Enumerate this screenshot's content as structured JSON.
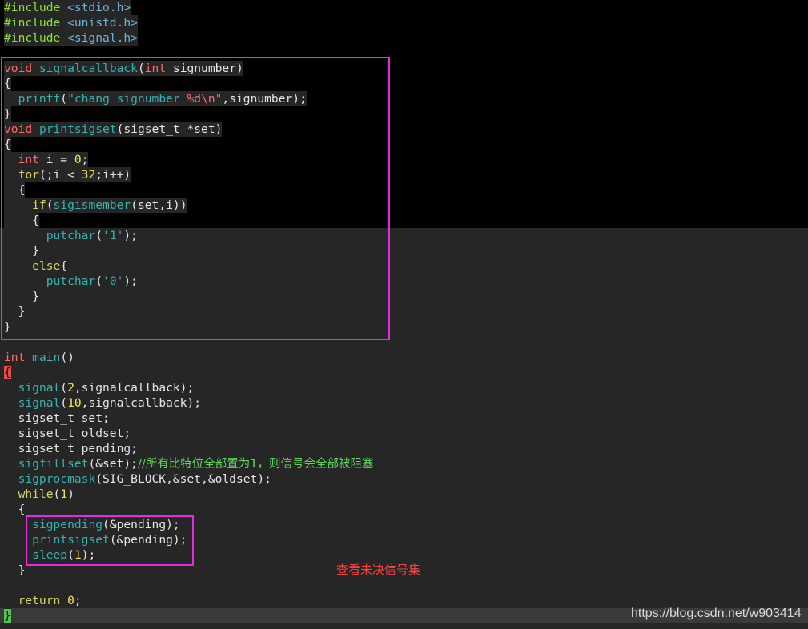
{
  "editor": {
    "lines": [
      [
        [
          "pre",
          "#include "
        ],
        [
          "header",
          "<stdio.h>"
        ]
      ],
      [
        [
          "pre",
          "#include "
        ],
        [
          "header",
          "<unistd.h>"
        ]
      ],
      [
        [
          "pre",
          "#include "
        ],
        [
          "header",
          "<signal.h>"
        ]
      ],
      [],
      [
        [
          "type",
          "void"
        ],
        [
          "plain",
          " "
        ],
        [
          "func",
          "signalcallback"
        ],
        [
          "plain",
          "("
        ],
        [
          "type",
          "int"
        ],
        [
          "plain",
          " signumber)"
        ]
      ],
      [
        [
          "plain",
          "{"
        ]
      ],
      [
        [
          "plain",
          "  "
        ],
        [
          "func",
          "printf"
        ],
        [
          "plain",
          "("
        ],
        [
          "str",
          "\"chang signumber "
        ],
        [
          "fmt",
          "%d\\n"
        ],
        [
          "str",
          "\""
        ],
        [
          "plain",
          ",signumber);"
        ]
      ],
      [
        [
          "plain",
          "}"
        ]
      ],
      [
        [
          "type",
          "void"
        ],
        [
          "plain",
          " "
        ],
        [
          "func",
          "printsigset"
        ],
        [
          "plain",
          "(sigset_t *set)"
        ]
      ],
      [
        [
          "plain",
          "{"
        ]
      ],
      [
        [
          "plain",
          "  "
        ],
        [
          "type",
          "int"
        ],
        [
          "plain",
          " i = "
        ],
        [
          "num",
          "0"
        ],
        [
          "plain",
          ";"
        ]
      ],
      [
        [
          "plain",
          "  "
        ],
        [
          "kw",
          "for"
        ],
        [
          "plain",
          "(;i < "
        ],
        [
          "num",
          "32"
        ],
        [
          "plain",
          ";i++)"
        ]
      ],
      [
        [
          "plain",
          "  {"
        ]
      ],
      [
        [
          "plain",
          "    "
        ],
        [
          "kw",
          "if"
        ],
        [
          "plain",
          "("
        ],
        [
          "func",
          "sigismember"
        ],
        [
          "plain",
          "(set,i))"
        ]
      ],
      [
        [
          "plain",
          "    {"
        ]
      ],
      [
        [
          "plain",
          "      "
        ],
        [
          "func",
          "putchar"
        ],
        [
          "plain",
          "("
        ],
        [
          "str",
          "'1'"
        ],
        [
          "plain",
          ");"
        ]
      ],
      [
        [
          "plain",
          "    }"
        ]
      ],
      [
        [
          "plain",
          "    "
        ],
        [
          "kw",
          "else"
        ],
        [
          "plain",
          "{"
        ]
      ],
      [
        [
          "plain",
          "      "
        ],
        [
          "func",
          "putchar"
        ],
        [
          "plain",
          "("
        ],
        [
          "str",
          "'0'"
        ],
        [
          "plain",
          ");"
        ]
      ],
      [
        [
          "plain",
          "    }"
        ]
      ],
      [
        [
          "plain",
          "  }"
        ]
      ],
      [
        [
          "plain",
          "}"
        ]
      ],
      [],
      [
        [
          "type",
          "int"
        ],
        [
          "plain",
          " "
        ],
        [
          "func",
          "main"
        ],
        [
          "plain",
          "()"
        ]
      ],
      [
        [
          "brace-red",
          "{"
        ]
      ],
      [
        [
          "plain",
          "  "
        ],
        [
          "func",
          "signal"
        ],
        [
          "plain",
          "("
        ],
        [
          "num",
          "2"
        ],
        [
          "plain",
          ",signalcallback);"
        ]
      ],
      [
        [
          "plain",
          "  "
        ],
        [
          "func",
          "signal"
        ],
        [
          "plain",
          "("
        ],
        [
          "num",
          "10"
        ],
        [
          "plain",
          ",signalcallback);"
        ]
      ],
      [
        [
          "plain",
          "  sigset_t set;"
        ]
      ],
      [
        [
          "plain",
          "  sigset_t oldset;"
        ]
      ],
      [
        [
          "plain",
          "  sigset_t pending;"
        ]
      ],
      [
        [
          "plain",
          "  "
        ],
        [
          "func",
          "sigfillset"
        ],
        [
          "plain",
          "(&set);"
        ],
        [
          "cmt",
          "//所有比特位全部置为1，则信号会全部被阻塞"
        ]
      ],
      [
        [
          "plain",
          "  "
        ],
        [
          "func",
          "sigprocmask"
        ],
        [
          "plain",
          "(SIG_BLOCK,&set,&oldset);"
        ]
      ],
      [
        [
          "plain",
          "  "
        ],
        [
          "kw",
          "while"
        ],
        [
          "plain",
          "("
        ],
        [
          "num",
          "1"
        ],
        [
          "plain",
          ")"
        ]
      ],
      [
        [
          "plain",
          "  {"
        ]
      ],
      [
        [
          "plain",
          "    "
        ],
        [
          "func",
          "sigpending"
        ],
        [
          "plain",
          "(&pending);"
        ]
      ],
      [
        [
          "plain",
          "    "
        ],
        [
          "func",
          "printsigset"
        ],
        [
          "plain",
          "(&pending);"
        ]
      ],
      [
        [
          "plain",
          "    "
        ],
        [
          "func",
          "sleep"
        ],
        [
          "plain",
          "("
        ],
        [
          "num",
          "1"
        ],
        [
          "plain",
          ");"
        ]
      ],
      [
        [
          "plain",
          "  }"
        ]
      ],
      [],
      [
        [
          "plain",
          "  "
        ],
        [
          "kw",
          "return"
        ],
        [
          "plain",
          " "
        ],
        [
          "num",
          "0"
        ],
        [
          "plain",
          ";"
        ]
      ],
      [
        [
          "brace-green",
          "}"
        ]
      ]
    ]
  },
  "annotation": {
    "note": "查看未决信号集"
  },
  "watermark": {
    "text": "https://blog.csdn.net/w903414"
  }
}
